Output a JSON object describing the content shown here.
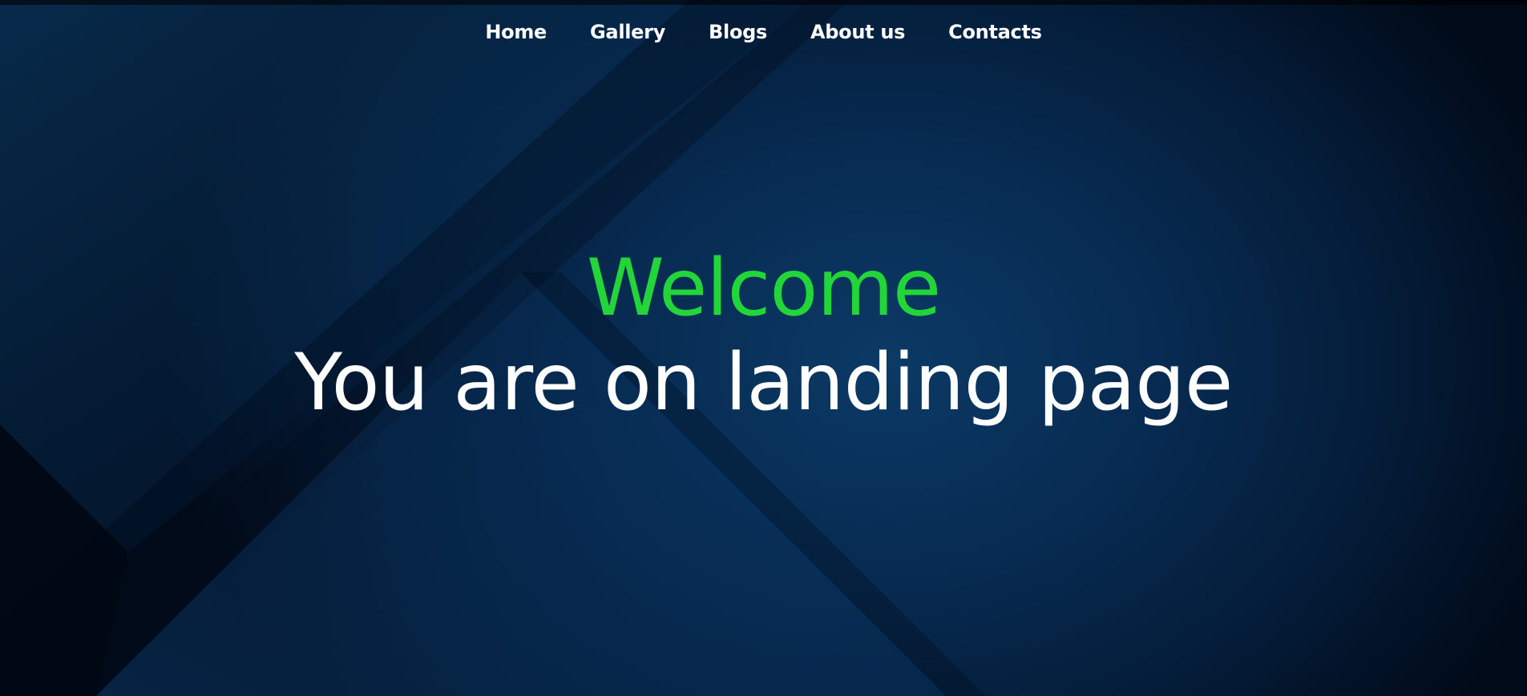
{
  "nav": {
    "items": [
      {
        "label": "Home"
      },
      {
        "label": "Gallery"
      },
      {
        "label": "Blogs"
      },
      {
        "label": "About us"
      },
      {
        "label": "Contacts"
      }
    ]
  },
  "hero": {
    "title": "Welcome",
    "subtitle": "You are on landing page"
  },
  "colors": {
    "accent": "#22d63a",
    "text": "#ffffff",
    "background": "#072a50"
  }
}
